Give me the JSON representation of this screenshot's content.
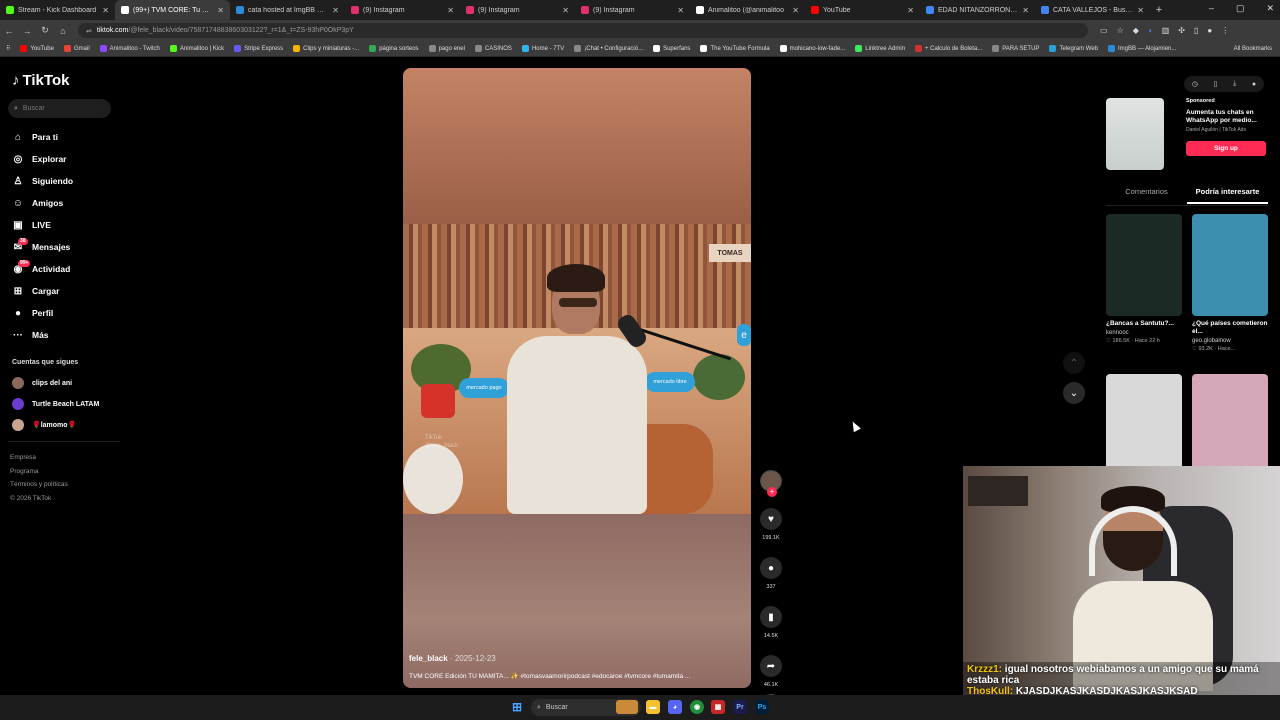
{
  "browser": {
    "tabs": [
      {
        "label": "Stream - Kick Dashboard",
        "color": "#53fc18"
      },
      {
        "label": "(99+) TVM CORE: Tu Man",
        "color": "#ffffff"
      },
      {
        "label": "cata hosted at ImgBB — ImgB",
        "color": "#2a8cd8"
      },
      {
        "label": "(9) Instagram",
        "color": "#e1306c"
      },
      {
        "label": "(9) Instagram",
        "color": "#e1306c"
      },
      {
        "label": "(9) Instagram",
        "color": "#e1306c"
      },
      {
        "label": "Animalitoo (@animalitoo",
        "color": "#ffffff"
      },
      {
        "label": "YouTube",
        "color": "#ff0000"
      },
      {
        "label": "EDAD NITANZORRON - Busca",
        "color": "#4285f4"
      },
      {
        "label": "CATA VALLEJOS - Buscar con",
        "color": "#4285f4"
      }
    ],
    "new_tab": "+",
    "window_controls": {
      "minimize": "–",
      "maximize": "▢",
      "close": "✕"
    },
    "url_domain": "tiktok.com",
    "url_path": "/@fele_black/video/7587174883860303122?_r=1&_t=ZS-93hP0OkP3pY",
    "bookmarks": [
      {
        "label": "YouTube",
        "color": "#ff0000"
      },
      {
        "label": "Gmail",
        "color": "#ea4335"
      },
      {
        "label": "Animalitoo - Twitch",
        "color": "#9146ff"
      },
      {
        "label": "Animalitoo | Kick",
        "color": "#53fc18"
      },
      {
        "label": "Stripe Express",
        "color": "#635bff"
      },
      {
        "label": "Clips y miniaturas -...",
        "color": "#f4b400"
      },
      {
        "label": "página sorteos",
        "color": "#34a853"
      },
      {
        "label": "pago enel",
        "color": "#888888"
      },
      {
        "label": "CASINOS",
        "color": "#888888"
      },
      {
        "label": "Home - 7TV",
        "color": "#29b6f6"
      },
      {
        "label": "¡Chat • Configuració...",
        "color": "#888888"
      },
      {
        "label": "Superfans",
        "color": "#ffffff"
      },
      {
        "label": "The YouTube Formula",
        "color": "#ffffff"
      },
      {
        "label": "mohicano-low-fade...",
        "color": "#ffffff"
      },
      {
        "label": "Linktree Admin",
        "color": "#43e660"
      },
      {
        "label": "+ Calculo de Boleta...",
        "color": "#d32f2f"
      },
      {
        "label": "PARA SETUP",
        "color": "#888888"
      },
      {
        "label": "Telegram Web",
        "color": "#2aa1da"
      },
      {
        "label": "ImgBB — Alojamien...",
        "color": "#2a8cd8"
      }
    ],
    "all_bookmarks": "All Bookmarks"
  },
  "sidebar": {
    "logo": "TikTok",
    "search_placeholder": "Buscar",
    "nav": [
      {
        "label": "Para ti",
        "icon": "home-icon",
        "glyph": "⌂"
      },
      {
        "label": "Explorar",
        "icon": "compass-icon",
        "glyph": "◎"
      },
      {
        "label": "Siguiendo",
        "icon": "following-icon",
        "glyph": "♙"
      },
      {
        "label": "Amigos",
        "icon": "friends-icon",
        "glyph": "☺"
      },
      {
        "label": "LIVE",
        "icon": "live-icon",
        "glyph": "▣"
      },
      {
        "label": "Mensajes",
        "icon": "messages-icon",
        "glyph": "✉",
        "badge": "38"
      },
      {
        "label": "Actividad",
        "icon": "activity-icon",
        "glyph": "◉",
        "badge": "99+"
      },
      {
        "label": "Cargar",
        "icon": "upload-icon",
        "glyph": "⊞"
      },
      {
        "label": "Perfil",
        "icon": "profile-icon",
        "glyph": "●"
      },
      {
        "label": "Más",
        "icon": "more-icon",
        "glyph": "···"
      }
    ],
    "following_heading": "Cuentas que sigues",
    "following": [
      {
        "label": "clips del ani",
        "color": "#8a6a5a"
      },
      {
        "label": "Turtle Beach LATAM",
        "color": "#6c3cd1"
      },
      {
        "label": "🌹lamomo🌹",
        "color": "#c9a48e"
      }
    ],
    "footer": [
      "Empresa",
      "Programa",
      "Términos y políticas",
      "© 2026 TikTok"
    ]
  },
  "video": {
    "sign": "TOMAS",
    "brand_badge": "mercado pago",
    "brand_badge_2": "mercado libre",
    "watermark_1": "TikTok",
    "watermark_2": "@fele_black",
    "author": "fele_black",
    "date": "· 2025-12-23",
    "description": "TVM CORE Edición TU MAMITA... ✨ #tomasvaamorirpodcast #edocaroe #tvmcore #tumamita ..."
  },
  "actions": {
    "likes": "199.1K",
    "comments": "337",
    "saves": "14.5K",
    "shares": "46.1K"
  },
  "right_panel": {
    "sponsored": "Sponsored",
    "ad_title": "Aumenta tus chats en WhatsApp por medio...",
    "ad_sub": "Daniel Aguilón | TikTok Ads",
    "signup": "Sign up",
    "tab_comments": "Comentarios",
    "tab_interest": "Podría interesarte",
    "cards": [
      {
        "title": "¿Bancas a Santutu?...",
        "user": "kennooc",
        "meta": "♡ 186.5K · Hace 22 h",
        "color": "#1b2a24"
      },
      {
        "title": "¿Qué países cometieron el...",
        "user": "geo.globalnow",
        "meta": "♡ 93.2K · Hace...",
        "color": "#3d8fb0"
      },
      {
        "title": "",
        "user": "",
        "meta": "",
        "color": "#d9d9d9"
      },
      {
        "title": "",
        "user": "",
        "meta": "",
        "color": "#d4a8b8"
      }
    ]
  },
  "overlay": {
    "chat_1_user": "Krzzz1:",
    "chat_1_text": "igual nosotros webiabamos a un amigo que su mamá estaba rica",
    "chat_2_user": "ThosKull:",
    "chat_2_text": "KJASDJKASJKASDJKASJKASJKSAD"
  },
  "taskbar": {
    "search": "Buscar"
  }
}
